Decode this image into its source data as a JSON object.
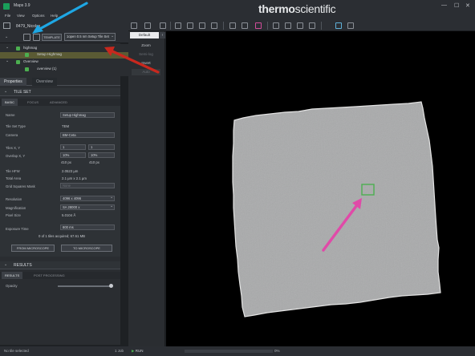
{
  "window": {
    "title": "Maps 3.9",
    "minimize": "—",
    "maximize": "☐",
    "close": "✕"
  },
  "brand": {
    "part1": "thermo",
    "part2": "scientific"
  },
  "menu": [
    "File",
    "View",
    "Options",
    "Help"
  ],
  "project": {
    "name": "8479_Nicolas"
  },
  "template": {
    "button": "TEMPLATE",
    "selected": "1open 0.5 nm Setup Tile Set"
  },
  "tree": [
    {
      "label": "highmag",
      "level": 1
    },
    {
      "label": "Setup Highmag",
      "level": 2
    },
    {
      "label": "Overview",
      "level": 1
    },
    {
      "label": "overview (1)",
      "level": 2
    }
  ],
  "panel_tabs": [
    "Properties",
    "Overview"
  ],
  "tile_set": {
    "header": "TILE SET",
    "subtabs": [
      "BASIC",
      "FOCUS",
      "ADVANCED"
    ],
    "fields": {
      "name_label": "Name",
      "name_value": "Setup Highmag",
      "type_label": "Tile Set Type",
      "type_value": "TEM",
      "camera_label": "Camera",
      "camera_value": "BM-Ceta",
      "tiles_label": "Tiles X, Y",
      "tiles_x": "1",
      "tiles_y": "1",
      "overlap_label": "Overlap X, Y",
      "overlap_x": "10%",
      "overlap_y": "10%",
      "px_x": "410 px",
      "px_y": "410 px",
      "hfw_label": "Tile HFW",
      "hfw_value": "2.0523 µm",
      "area_label": "Total Area",
      "area_value": "2.1 µm x 2.1 µm",
      "grid_label": "Grid Squares Mask",
      "grid_value": "None",
      "resolution_label": "Resolution",
      "resolution_value": "4096 x 4096",
      "magnification_label": "Magnification",
      "magnification_value": "SA 28000 x",
      "pixel_label": "Pixel Size",
      "pixel_value": "5.0104 Å",
      "exposure_label": "Exposure Time",
      "exposure_value": "800 ms",
      "acquired": "0 of 1 tiles acquired; 67.61 MB"
    },
    "from_microscope": "FROM MICROSCOPE",
    "to_microscope": "TO MICROSCOPE"
  },
  "results": {
    "header": "RESULTS",
    "subtabs": [
      "RESULTS",
      "POST PROCESSING"
    ],
    "opacity_label": "Opacity",
    "opacity_value": 0.95
  },
  "mid_panel": {
    "tab": "Default",
    "buttons": [
      "Zoom",
      "Semi-log",
      "Invert",
      "Auto"
    ]
  },
  "status": {
    "left": "No tile selected",
    "count": "1 Job",
    "run": "RUN",
    "zoom": "0%"
  },
  "colors": {
    "accent_green": "#4caf50",
    "arrow_blue": "#1ea7e4",
    "arrow_red": "#c8281e",
    "arrow_pink": "#e04aa8",
    "selection": "#5a5a34"
  }
}
